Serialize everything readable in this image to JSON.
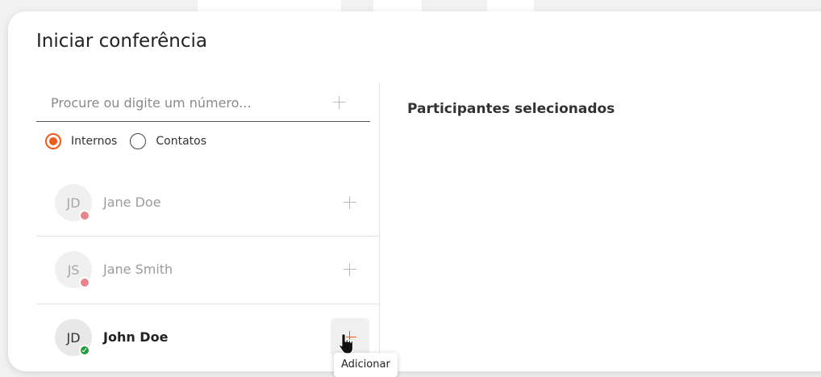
{
  "dialog": {
    "title": "Iniciar conferência"
  },
  "search": {
    "placeholder": "Procure ou digite um número...",
    "value": "",
    "add_icon": "plus-icon"
  },
  "filters": [
    {
      "label": "Internos",
      "checked": true
    },
    {
      "label": "Contatos",
      "checked": false
    }
  ],
  "contacts": [
    {
      "initials": "JD",
      "name": "Jane Doe",
      "status": "busy",
      "status_color": "#e8848c"
    },
    {
      "initials": "JS",
      "name": "Jane Smith",
      "status": "busy",
      "status_color": "#e8848c"
    },
    {
      "initials": "JD",
      "name": "John Doe",
      "status": "online",
      "status_color": "#1f9d3a"
    }
  ],
  "tooltip": {
    "text": "Adicionar"
  },
  "selected_panel": {
    "title": "Participantes selecionados"
  },
  "colors": {
    "accent": "#f05a1a",
    "busy": "#e8848c",
    "online": "#1f9d3a"
  },
  "icons": {
    "add": "plus-icon",
    "cursor": "hand-pointer-icon",
    "online_badge": "check-icon"
  }
}
